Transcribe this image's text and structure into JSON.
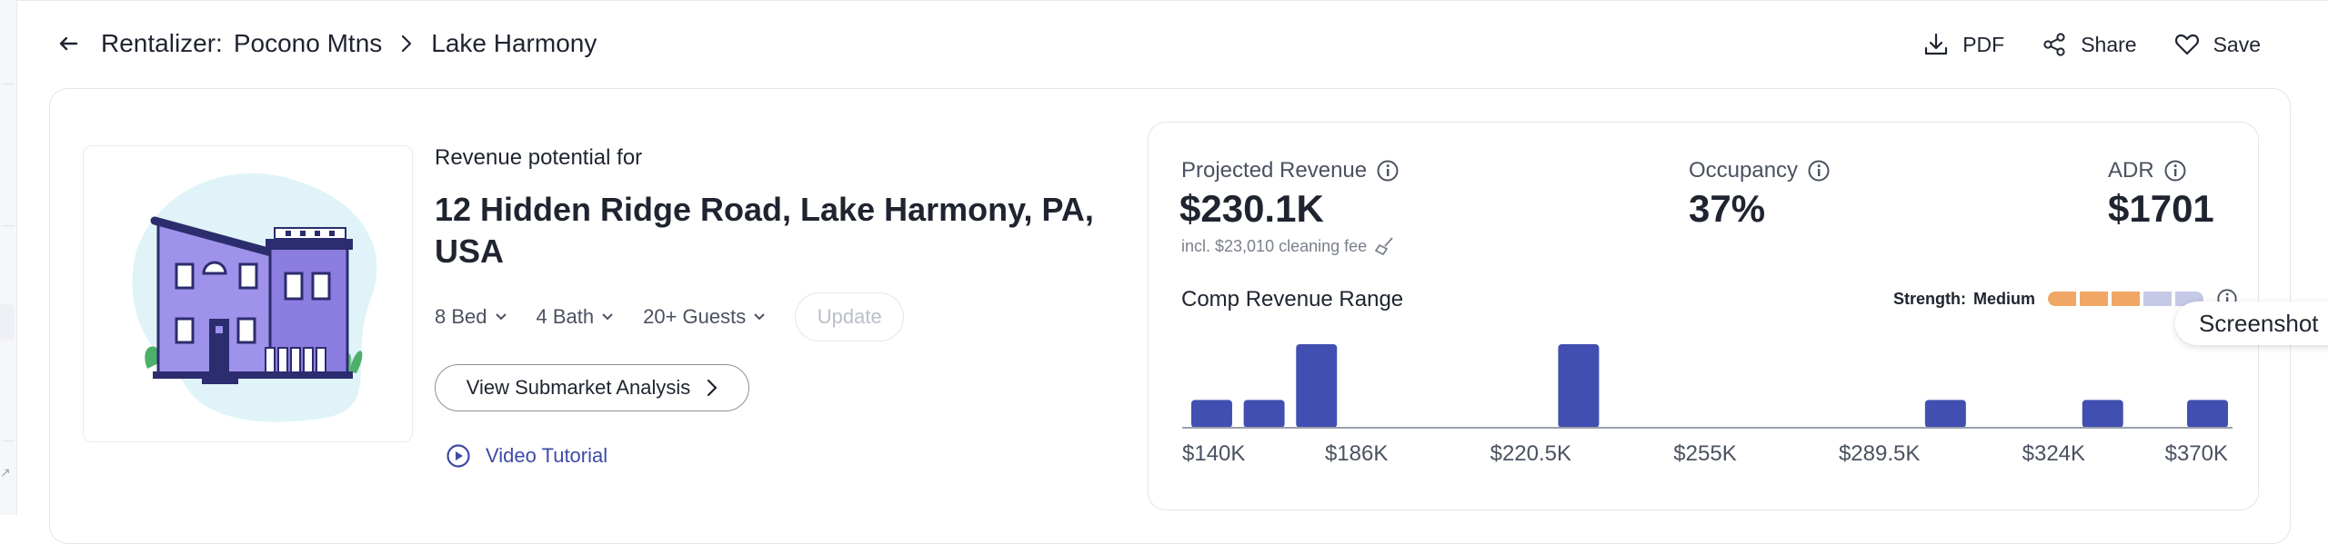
{
  "topbar": {
    "brand": "Rentalizer:",
    "breadcrumbs": [
      "Pocono Mtns",
      "Lake Harmony"
    ],
    "actions": [
      {
        "label": "PDF",
        "icon": "download-icon"
      },
      {
        "label": "Share",
        "icon": "share-icon"
      },
      {
        "label": "Save",
        "icon": "heart-icon"
      }
    ]
  },
  "property": {
    "revenue_label": "Revenue potential for",
    "address": "12 Hidden Ridge Road, Lake Harmony, PA, USA",
    "filters": {
      "bed": "8 Bed",
      "bath": "4 Bath",
      "guests": "20+ Guests"
    },
    "update_label": "Update",
    "submarket_label": "View Submarket Analysis",
    "video_label": "Video Tutorial"
  },
  "stats": {
    "projected_label": "Projected Revenue",
    "projected_value": "$230.1K",
    "cleaning_fee": "incl. $23,010 cleaning fee",
    "occupancy_label": "Occupancy",
    "occupancy_value": "37%",
    "adr_label": "ADR",
    "adr_value": "$1701"
  },
  "comp": {
    "title": "Comp Revenue Range",
    "strength_label": "Strength:",
    "strength_value": "Medium",
    "strength_level": 3,
    "strength_total": 5,
    "tooltip": "Screenshot"
  },
  "colors": {
    "bar": "#414fb1",
    "strength_on": "#f0a766",
    "strength_off": "#c5c9e6",
    "link": "#3e4aa8"
  },
  "chart_data": {
    "type": "bar",
    "tick_labels": [
      "$140K",
      "$186K",
      "$220.5K",
      "$255K",
      "$289.5K",
      "$324K",
      "$370K"
    ],
    "bins": [
      1,
      1,
      3,
      0,
      0,
      0,
      0,
      3,
      0,
      0,
      0,
      0,
      0,
      0,
      1,
      0,
      0,
      1,
      0,
      1
    ],
    "ylim": [
      0,
      3
    ]
  }
}
